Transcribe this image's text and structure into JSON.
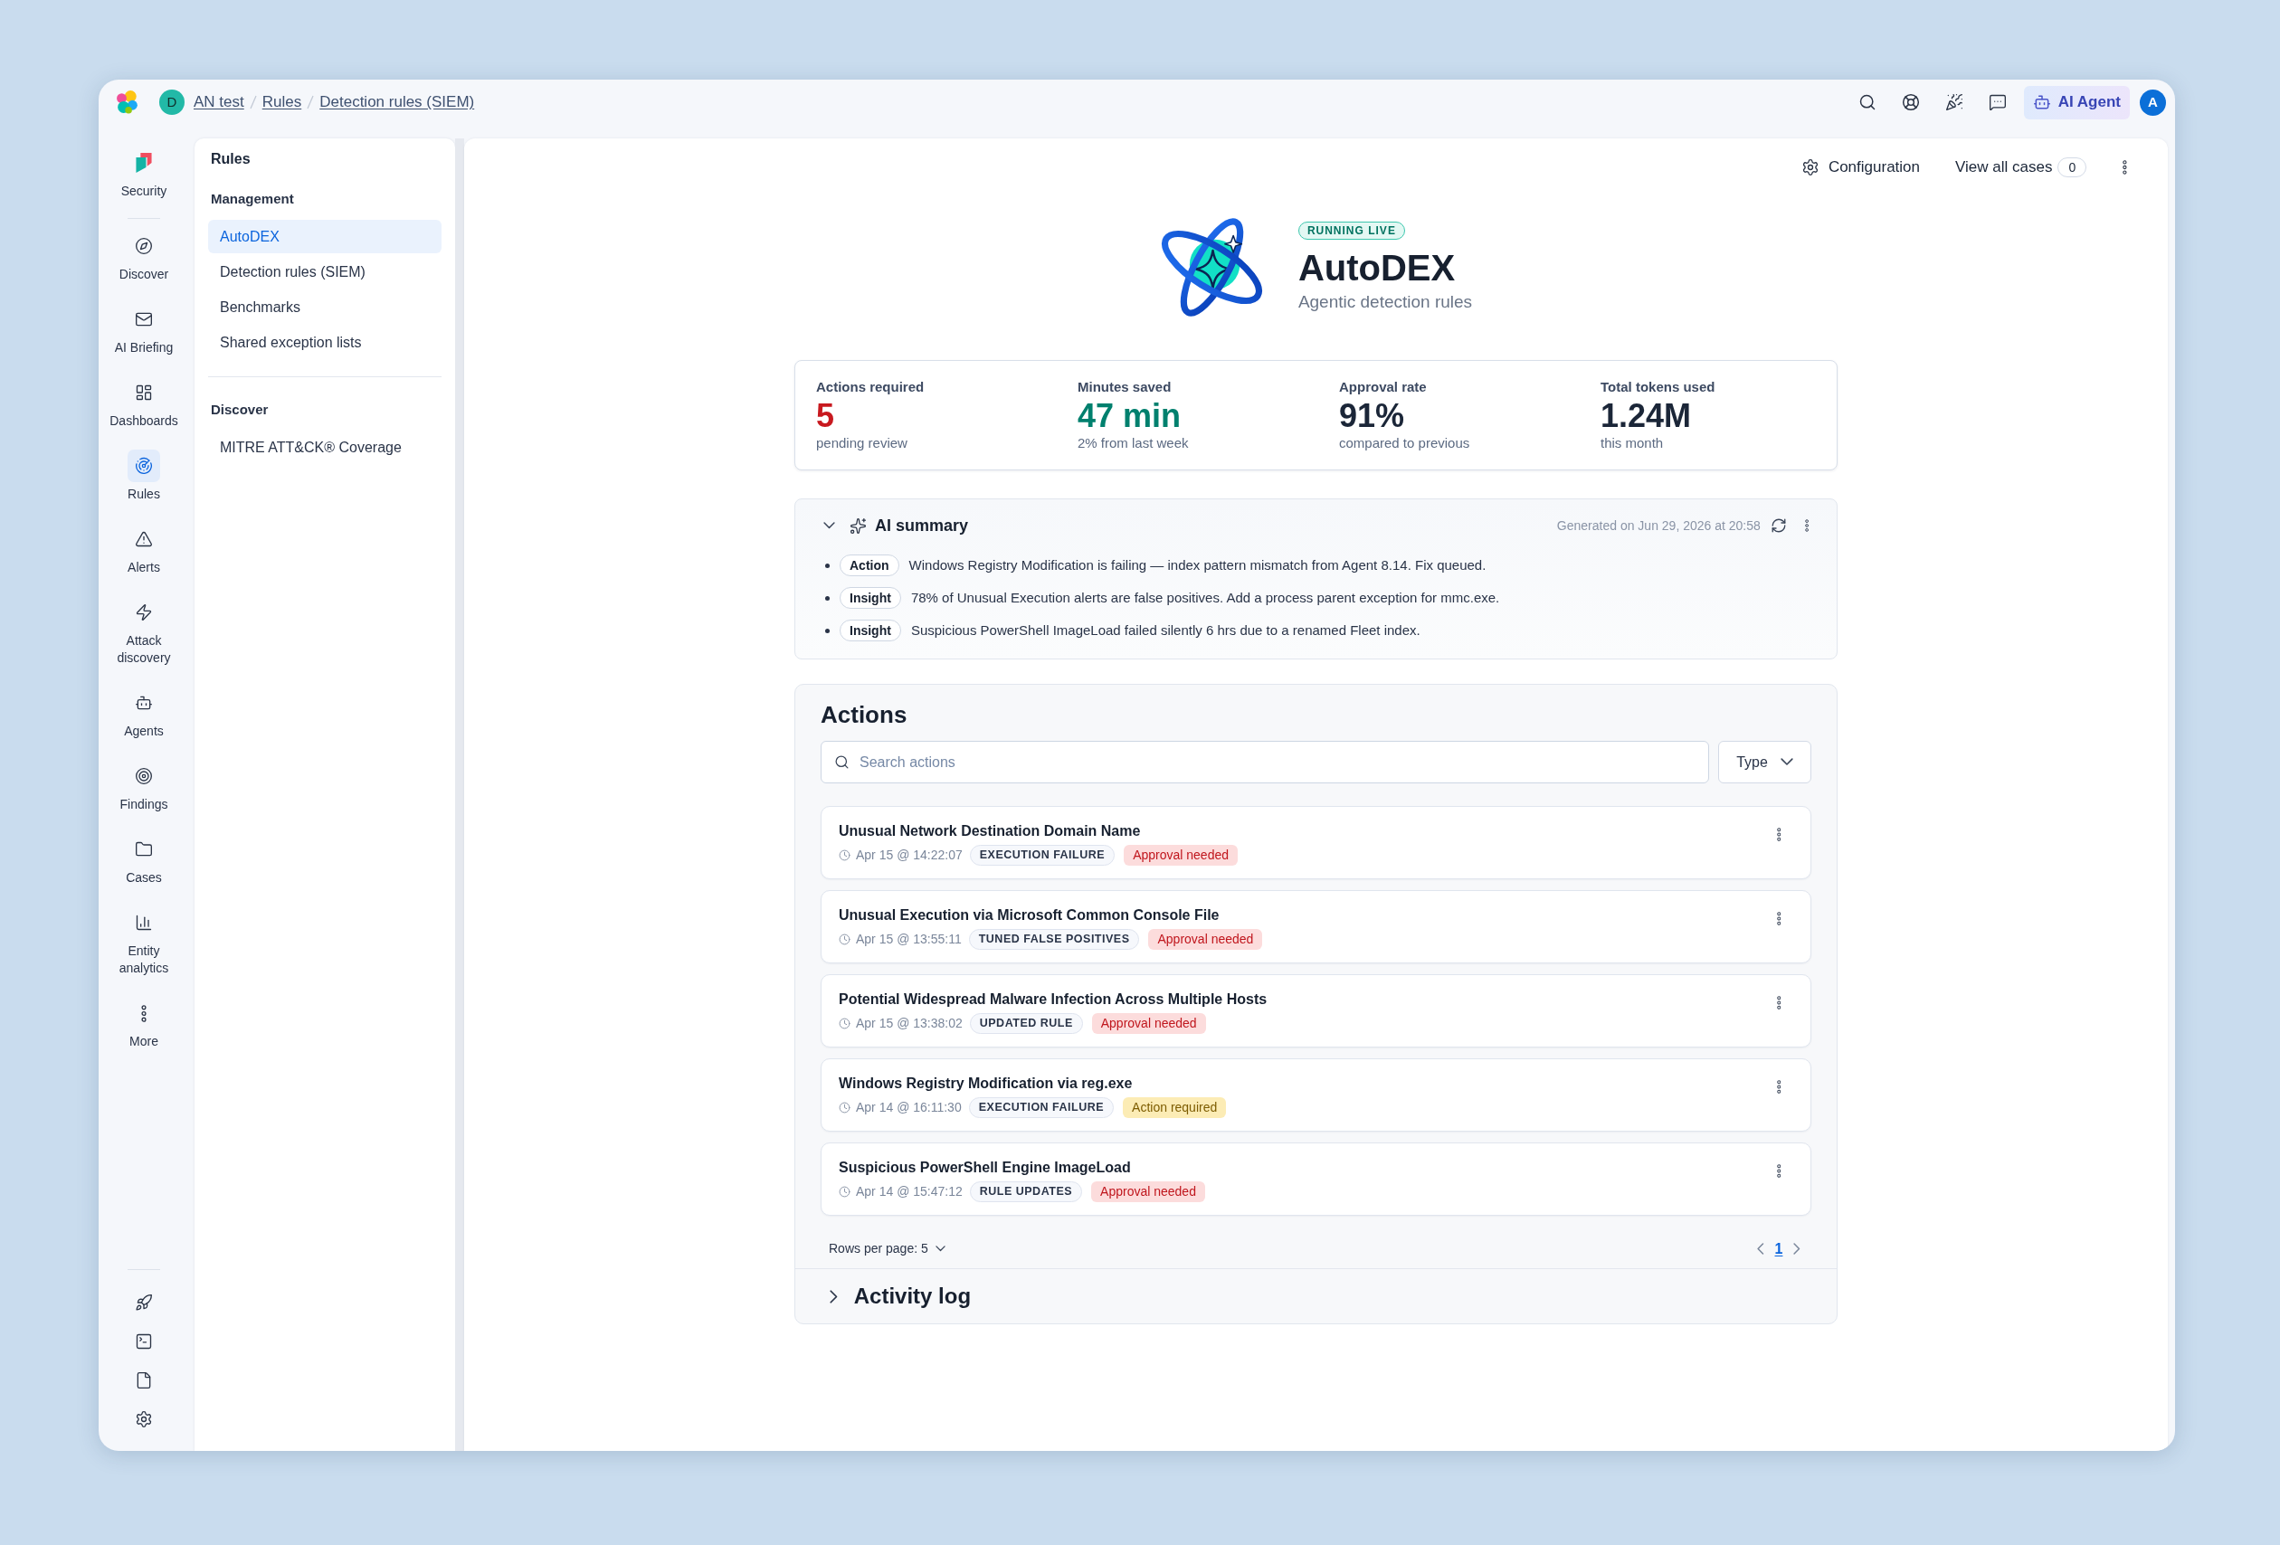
{
  "top_bar": {
    "space_avatar": "D",
    "breadcrumbs": [
      {
        "label": "AN test"
      },
      {
        "label": "Rules"
      },
      {
        "label": "Detection rules (SIEM)"
      }
    ],
    "ai_agent_button": "AI Agent",
    "user_avatar": "A"
  },
  "nav": {
    "app": "Security",
    "items": [
      {
        "label": "Discover",
        "selected": false
      },
      {
        "label": "AI Briefing",
        "selected": false
      },
      {
        "label": "Dashboards",
        "selected": false
      },
      {
        "label": "Rules",
        "selected": true
      },
      {
        "label": "Alerts",
        "selected": false
      },
      {
        "label": "Attack discovery",
        "selected": false
      },
      {
        "label": "Agents",
        "selected": false
      },
      {
        "label": "Findings",
        "selected": false
      },
      {
        "label": "Cases",
        "selected": false
      },
      {
        "label": "Entity analytics",
        "selected": false
      },
      {
        "label": "More",
        "selected": false
      }
    ]
  },
  "side_panel": {
    "title": "Rules",
    "sections": [
      {
        "heading": "Management",
        "items": [
          {
            "label": "AutoDEX",
            "selected": true
          },
          {
            "label": "Detection rules (SIEM)",
            "selected": false
          },
          {
            "label": "Benchmarks",
            "selected": false
          },
          {
            "label": "Shared exception lists",
            "selected": false
          }
        ]
      },
      {
        "heading": "Discover",
        "items": [
          {
            "label": "MITRE ATT&CK® Coverage",
            "selected": false
          }
        ]
      }
    ]
  },
  "header_actions": {
    "configuration": "Configuration",
    "view_all_cases": "View all cases",
    "cases_count": "0"
  },
  "hero": {
    "status": "RUNNING LIVE",
    "title": "AutoDEX",
    "subtitle": "Agentic detection rules"
  },
  "stats": [
    {
      "label": "Actions required",
      "value": "5",
      "note": "pending review",
      "color": "#c8191f"
    },
    {
      "label": "Minutes saved",
      "value": "47 min",
      "note": "2% from last week",
      "color": "#00806e"
    },
    {
      "label": "Approval rate",
      "value": "91%",
      "note": "compared to previous",
      "color": "#1b2638"
    },
    {
      "label": "Total tokens used",
      "value": "1.24M",
      "note": "this month",
      "color": "#1b2638"
    }
  ],
  "ai_summary": {
    "title": "AI summary",
    "expanded": true,
    "generated": "Generated on Jun 29, 2026 at 20:58",
    "items": [
      {
        "tag": "Action",
        "text": "Windows Registry Modification is failing — index pattern mismatch from Agent 8.14. Fix queued."
      },
      {
        "tag": "Insight",
        "text": "78% of Unusual Execution alerts are false positives. Add a process parent exception for mmc.exe."
      },
      {
        "tag": "Insight",
        "text": "Suspicious PowerShell ImageLoad failed silently 6 hrs due to a renamed Fleet index."
      }
    ]
  },
  "actions": {
    "title": "Actions",
    "search": {
      "placeholder": "Search actions"
    },
    "filter": "Type",
    "rows": [
      {
        "title": "Unusual Network Destination Domain Name",
        "time": "Apr 15 @ 14:22:07",
        "category": "EXECUTION FAILURE",
        "status": "Approval needed",
        "kind": "approval"
      },
      {
        "title": "Unusual Execution via Microsoft Common Console File",
        "time": "Apr 15 @ 13:55:11",
        "category": "TUNED FALSE POSITIVES",
        "status": "Approval needed",
        "kind": "approval"
      },
      {
        "title": "Potential Widespread Malware Infection Across Multiple Hosts",
        "time": "Apr 15 @ 13:38:02",
        "category": "UPDATED RULE",
        "status": "Approval needed",
        "kind": "approval"
      },
      {
        "title": "Windows Registry Modification via reg.exe",
        "time": "Apr 14 @ 16:11:30",
        "category": "EXECUTION FAILURE",
        "status": "Action required",
        "kind": "action"
      },
      {
        "title": "Suspicious PowerShell Engine ImageLoad",
        "time": "Apr 14 @ 15:47:12",
        "category": "RULE UPDATES",
        "status": "Approval needed",
        "kind": "approval"
      }
    ],
    "rows_per_page": "Rows per page: 5",
    "pages": [
      {
        "label": "1",
        "selected": true
      }
    ]
  },
  "activity_log": {
    "title": "Activity log",
    "expanded": false
  }
}
